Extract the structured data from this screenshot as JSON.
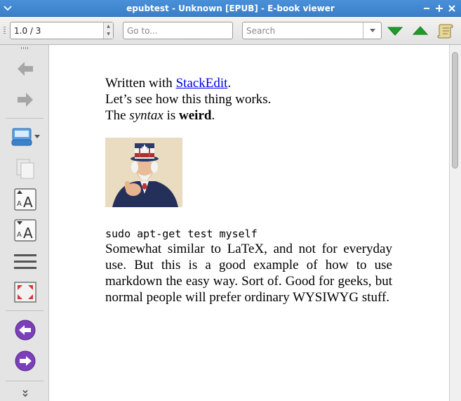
{
  "window": {
    "title": "epubtest - Unknown [EPUB] - E-book viewer"
  },
  "toolbar": {
    "position_value": "1.0 / 3",
    "goto_placeholder": "Go to...",
    "search_placeholder": "Search",
    "icons": [
      "next-result-icon",
      "previous-result-icon",
      "table-of-contents-icon"
    ]
  },
  "sidebar": {
    "icons": [
      "back-icon",
      "forward-icon",
      "print-icon",
      "copy-icon",
      "font-size-larger-icon",
      "font-size-smaller-icon",
      "preferences-menu-icon",
      "fullscreen-icon",
      "previous-page-icon",
      "next-page-icon",
      "more-icon"
    ]
  },
  "document": {
    "line1_prefix": "Written with ",
    "line1_link": "StackEdit",
    "line1_suffix": ".",
    "line2": "Let’s see how this thing works.",
    "line3_prefix": "The ",
    "line3_em": "syntax",
    "line3_mid": " is ",
    "line3_strong": "weird",
    "line3_suffix": ".",
    "code": "sudo apt-get test myself",
    "paragraph": "Somewhat similar to LaTeX, and not for everyday use. But this is a good example of how to use markdown the easy way. Sort of. Good for geeks, but normal people will prefer ordinary WYSIWYG stuff."
  },
  "colors": {
    "titlebar": "#4a90d9",
    "link": "#0000ee",
    "green_arrow": "#1f9d2a",
    "purple_arrow": "#7b3fb8"
  }
}
